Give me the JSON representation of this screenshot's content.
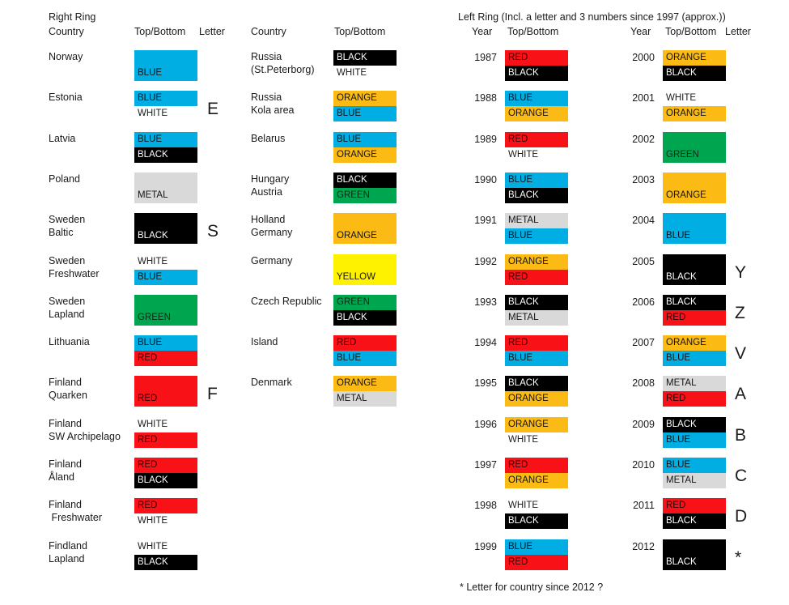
{
  "palette": {
    "BLUE": "#00AEE4",
    "BLACK": "#000000",
    "RED": "#F91118",
    "GREEN": "#00A550",
    "ORANGE": "#FBBA14",
    "YELLOW": "#FFF200",
    "METAL": "#D9D9D9",
    "WHITE": "#FFFFFF"
  },
  "right_ring": {
    "title_line1": "Right Ring",
    "headers": {
      "country": "Country",
      "topbottom": "Top/Bottom",
      "letter": "Letter"
    },
    "rows": [
      {
        "label1": "Norway",
        "label2": "",
        "bands": [
          {
            "color": "BLUE",
            "text": ""
          },
          {
            "color": "BLUE",
            "text": "BLUE"
          }
        ],
        "letter": ""
      },
      {
        "label1": "Estonia",
        "label2": "",
        "bands": [
          {
            "color": "BLUE",
            "text": "BLUE"
          },
          {
            "color": "WHITE",
            "text": "WHITE"
          }
        ],
        "letter": "E"
      },
      {
        "label1": "Latvia",
        "label2": "",
        "bands": [
          {
            "color": "BLUE",
            "text": "BLUE"
          },
          {
            "color": "BLACK",
            "text": "BLACK"
          }
        ],
        "letter": ""
      },
      {
        "label1": "Poland",
        "label2": "",
        "bands": [
          {
            "color": "METAL",
            "text": ""
          },
          {
            "color": "METAL",
            "text": "METAL"
          }
        ],
        "letter": ""
      },
      {
        "label1": "Sweden",
        "label2": "Baltic",
        "bands": [
          {
            "color": "BLACK",
            "text": ""
          },
          {
            "color": "BLACK",
            "text": "BLACK"
          }
        ],
        "letter": "S"
      },
      {
        "label1": "Sweden",
        "label2": "Freshwater",
        "bands": [
          {
            "color": "WHITE",
            "text": "WHITE"
          },
          {
            "color": "BLUE",
            "text": "BLUE"
          }
        ],
        "letter": ""
      },
      {
        "label1": "Sweden",
        "label2": "Lapland",
        "bands": [
          {
            "color": "GREEN",
            "text": ""
          },
          {
            "color": "GREEN",
            "text": "GREEN"
          }
        ],
        "letter": ""
      },
      {
        "label1": "Lithuania",
        "label2": "",
        "bands": [
          {
            "color": "BLUE",
            "text": "BLUE"
          },
          {
            "color": "RED",
            "text": "RED"
          }
        ],
        "letter": ""
      },
      {
        "label1": "Finland",
        "label2": "Quarken",
        "bands": [
          {
            "color": "RED",
            "text": ""
          },
          {
            "color": "RED",
            "text": "RED"
          }
        ],
        "letter": "F"
      },
      {
        "label1": "Finland",
        "label2": "SW Archipelago",
        "bands": [
          {
            "color": "WHITE",
            "text": "WHITE"
          },
          {
            "color": "RED",
            "text": "RED"
          }
        ],
        "letter": ""
      },
      {
        "label1": "Finland",
        "label2": "Åland",
        "bands": [
          {
            "color": "RED",
            "text": "RED"
          },
          {
            "color": "BLACK",
            "text": "BLACK"
          }
        ],
        "letter": ""
      },
      {
        "label1": "Finland",
        "label2": " Freshwater",
        "bands": [
          {
            "color": "RED",
            "text": "RED"
          },
          {
            "color": "WHITE",
            "text": "WHITE"
          }
        ],
        "letter": ""
      },
      {
        "label1": "Findland",
        "label2": "Lapland",
        "bands": [
          {
            "color": "WHITE",
            "text": "WHITE"
          },
          {
            "color": "BLACK",
            "text": "BLACK"
          }
        ],
        "letter": ""
      }
    ]
  },
  "right_ring_col2": {
    "headers": {
      "country": "Country",
      "topbottom": "Top/Bottom"
    },
    "rows": [
      {
        "label1": "Russia",
        "label2": "(St.Peterborg)",
        "bands": [
          {
            "color": "BLACK",
            "text": "BLACK"
          },
          {
            "color": "WHITE",
            "text": "WHITE"
          }
        ]
      },
      {
        "label1": "Russia",
        "label2": "Kola area",
        "bands": [
          {
            "color": "ORANGE",
            "text": "ORANGE"
          },
          {
            "color": "BLUE",
            "text": "BLUE"
          }
        ]
      },
      {
        "label1": "Belarus",
        "label2": "",
        "bands": [
          {
            "color": "BLUE",
            "text": "BLUE"
          },
          {
            "color": "ORANGE",
            "text": "ORANGE"
          }
        ]
      },
      {
        "label1": "Hungary",
        "label2": "Austria",
        "bands": [
          {
            "color": "BLACK",
            "text": "BLACK"
          },
          {
            "color": "GREEN",
            "text": "GREEN"
          }
        ]
      },
      {
        "label1": "Holland",
        "label2": "Germany",
        "bands": [
          {
            "color": "ORANGE",
            "text": ""
          },
          {
            "color": "ORANGE",
            "text": "ORANGE"
          }
        ]
      },
      {
        "label1": "Germany",
        "label2": "",
        "bands": [
          {
            "color": "YELLOW",
            "text": ""
          },
          {
            "color": "YELLOW",
            "text": "YELLOW"
          }
        ]
      },
      {
        "label1": "Czech Republic",
        "label2": "",
        "bands": [
          {
            "color": "GREEN",
            "text": "GREEN"
          },
          {
            "color": "BLACK",
            "text": "BLACK"
          }
        ]
      },
      {
        "label1": "Island",
        "label2": "",
        "bands": [
          {
            "color": "RED",
            "text": "RED"
          },
          {
            "color": "BLUE",
            "text": "BLUE"
          }
        ]
      },
      {
        "label1": "Denmark",
        "label2": "",
        "bands": [
          {
            "color": "ORANGE",
            "text": "ORANGE"
          },
          {
            "color": "METAL",
            "text": "METAL"
          }
        ]
      }
    ]
  },
  "left_ring": {
    "title": "Left Ring (Incl. a letter and 3 numbers since 1997 (approx.))",
    "headers": {
      "year": "Year",
      "topbottom": "Top/Bottom",
      "year2": "Year",
      "topbottom2": "Top/Bottom",
      "letter": "Letter"
    },
    "rows_col1": [
      {
        "year": "1987",
        "bands": [
          {
            "color": "RED",
            "text": "RED"
          },
          {
            "color": "BLACK",
            "text": "BLACK"
          }
        ]
      },
      {
        "year": "1988",
        "bands": [
          {
            "color": "BLUE",
            "text": "BLUE"
          },
          {
            "color": "ORANGE",
            "text": "ORANGE"
          }
        ]
      },
      {
        "year": "1989",
        "bands": [
          {
            "color": "RED",
            "text": "RED"
          },
          {
            "color": "WHITE",
            "text": "WHITE"
          }
        ]
      },
      {
        "year": "1990",
        "bands": [
          {
            "color": "BLUE",
            "text": "BLUE"
          },
          {
            "color": "BLACK",
            "text": "BLACK"
          }
        ]
      },
      {
        "year": "1991",
        "bands": [
          {
            "color": "METAL",
            "text": "METAL"
          },
          {
            "color": "BLUE",
            "text": "BLUE"
          }
        ]
      },
      {
        "year": "1992",
        "bands": [
          {
            "color": "ORANGE",
            "text": "ORANGE"
          },
          {
            "color": "RED",
            "text": "RED"
          }
        ]
      },
      {
        "year": "1993",
        "bands": [
          {
            "color": "BLACK",
            "text": "BLACK"
          },
          {
            "color": "METAL",
            "text": "METAL"
          }
        ]
      },
      {
        "year": "1994",
        "bands": [
          {
            "color": "RED",
            "text": "RED"
          },
          {
            "color": "BLUE",
            "text": "BLUE"
          }
        ]
      },
      {
        "year": "1995",
        "bands": [
          {
            "color": "BLACK",
            "text": "BLACK"
          },
          {
            "color": "ORANGE",
            "text": "ORANGE"
          }
        ]
      },
      {
        "year": "1996",
        "bands": [
          {
            "color": "ORANGE",
            "text": "ORANGE"
          },
          {
            "color": "WHITE",
            "text": "WHITE"
          }
        ]
      },
      {
        "year": "1997",
        "bands": [
          {
            "color": "RED",
            "text": "RED"
          },
          {
            "color": "ORANGE",
            "text": "ORANGE"
          }
        ]
      },
      {
        "year": "1998",
        "bands": [
          {
            "color": "WHITE",
            "text": "WHITE"
          },
          {
            "color": "BLACK",
            "text": "BLACK"
          }
        ]
      },
      {
        "year": "1999",
        "bands": [
          {
            "color": "BLUE",
            "text": "BLUE"
          },
          {
            "color": "RED",
            "text": "RED"
          }
        ]
      }
    ],
    "rows_col2": [
      {
        "year": "2000",
        "bands": [
          {
            "color": "ORANGE",
            "text": "ORANGE"
          },
          {
            "color": "BLACK",
            "text": "BLACK"
          }
        ],
        "letter": ""
      },
      {
        "year": "2001",
        "bands": [
          {
            "color": "WHITE",
            "text": "WHITE"
          },
          {
            "color": "ORANGE",
            "text": "ORANGE"
          }
        ],
        "letter": ""
      },
      {
        "year": "2002",
        "bands": [
          {
            "color": "GREEN",
            "text": ""
          },
          {
            "color": "GREEN",
            "text": "GREEN"
          }
        ],
        "letter": ""
      },
      {
        "year": "2003",
        "bands": [
          {
            "color": "ORANGE",
            "text": ""
          },
          {
            "color": "ORANGE",
            "text": "ORANGE"
          }
        ],
        "letter": ""
      },
      {
        "year": "2004",
        "bands": [
          {
            "color": "BLUE",
            "text": ""
          },
          {
            "color": "BLUE",
            "text": "BLUE"
          }
        ],
        "letter": ""
      },
      {
        "year": "2005",
        "bands": [
          {
            "color": "BLACK",
            "text": ""
          },
          {
            "color": "BLACK",
            "text": "BLACK"
          }
        ],
        "letter": "Y"
      },
      {
        "year": "2006",
        "bands": [
          {
            "color": "BLACK",
            "text": "BLACK"
          },
          {
            "color": "RED",
            "text": "RED"
          }
        ],
        "letter": "Z"
      },
      {
        "year": "2007",
        "bands": [
          {
            "color": "ORANGE",
            "text": "ORANGE"
          },
          {
            "color": "BLUE",
            "text": "BLUE"
          }
        ],
        "letter": "V"
      },
      {
        "year": "2008",
        "bands": [
          {
            "color": "METAL",
            "text": "METAL"
          },
          {
            "color": "RED",
            "text": "RED"
          }
        ],
        "letter": "A"
      },
      {
        "year": "2009",
        "bands": [
          {
            "color": "BLACK",
            "text": "BLACK"
          },
          {
            "color": "BLUE",
            "text": "BLUE"
          }
        ],
        "letter": "B"
      },
      {
        "year": "2010",
        "bands": [
          {
            "color": "BLUE",
            "text": "BLUE"
          },
          {
            "color": "METAL",
            "text": "METAL"
          }
        ],
        "letter": "C"
      },
      {
        "year": "2011",
        "bands": [
          {
            "color": "RED",
            "text": "RED"
          },
          {
            "color": "BLACK",
            "text": "BLACK"
          }
        ],
        "letter": "D"
      },
      {
        "year": "2012",
        "bands": [
          {
            "color": "BLACK",
            "text": ""
          },
          {
            "color": "BLACK",
            "text": "BLACK"
          }
        ],
        "letter": "*"
      }
    ]
  },
  "footnote": "* Letter for country since 2012 ?"
}
